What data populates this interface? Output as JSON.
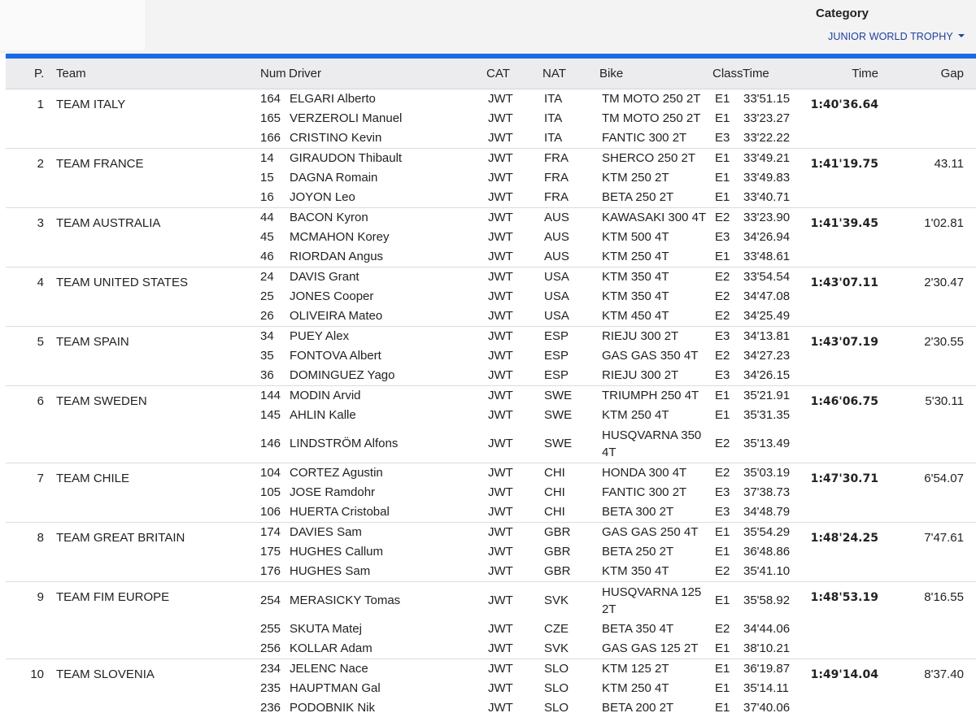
{
  "category": {
    "title": "Category",
    "selected": "JUNIOR WORLD TROPHY"
  },
  "columns": {
    "pos": "P.",
    "team": "Team",
    "num": "Num",
    "driver": "Driver",
    "cat": "CAT",
    "nat": "NAT",
    "bike": "Bike",
    "class": "Class",
    "class_time": "Time",
    "time": "Time",
    "gap": "Gap"
  },
  "teams": [
    {
      "pos": "1",
      "team": "TEAM ITALY",
      "time": "1:40'36.64",
      "gap": "",
      "riders": [
        {
          "num": "164",
          "driver": "ELGARI Alberto",
          "cat": "JWT",
          "nat": "ITA",
          "bike": "TM MOTO 250 2T",
          "class": "E1",
          "time": "33'51.15"
        },
        {
          "num": "165",
          "driver": "VERZEROLI Manuel",
          "cat": "JWT",
          "nat": "ITA",
          "bike": "TM MOTO 250 2T",
          "class": "E1",
          "time": "33'23.27"
        },
        {
          "num": "166",
          "driver": "CRISTINO Kevin",
          "cat": "JWT",
          "nat": "ITA",
          "bike": "FANTIC 300 2T",
          "class": "E3",
          "time": "33'22.22"
        }
      ]
    },
    {
      "pos": "2",
      "team": "TEAM FRANCE",
      "time": "1:41'19.75",
      "gap": "43.11",
      "riders": [
        {
          "num": "14",
          "driver": "GIRAUDON Thibault",
          "cat": "JWT",
          "nat": "FRA",
          "bike": "SHERCO 250 2T",
          "class": "E1",
          "time": "33'49.21"
        },
        {
          "num": "15",
          "driver": "DAGNA Romain",
          "cat": "JWT",
          "nat": "FRA",
          "bike": "KTM 250 2T",
          "class": "E1",
          "time": "33'49.83"
        },
        {
          "num": "16",
          "driver": "JOYON Leo",
          "cat": "JWT",
          "nat": "FRA",
          "bike": "BETA 250 2T",
          "class": "E1",
          "time": "33'40.71"
        }
      ]
    },
    {
      "pos": "3",
      "team": "TEAM AUSTRALIA",
      "time": "1:41'39.45",
      "gap": "1'02.81",
      "riders": [
        {
          "num": "44",
          "driver": "BACON Kyron",
          "cat": "JWT",
          "nat": "AUS",
          "bike": "KAWASAKI 300 4T",
          "class": "E2",
          "time": "33'23.90"
        },
        {
          "num": "45",
          "driver": "MCMAHON Korey",
          "cat": "JWT",
          "nat": "AUS",
          "bike": "KTM 500 4T",
          "class": "E3",
          "time": "34'26.94"
        },
        {
          "num": "46",
          "driver": "RIORDAN Angus",
          "cat": "JWT",
          "nat": "AUS",
          "bike": "KTM 250 4T",
          "class": "E1",
          "time": "33'48.61"
        }
      ]
    },
    {
      "pos": "4",
      "team": "TEAM UNITED STATES",
      "time": "1:43'07.11",
      "gap": "2'30.47",
      "riders": [
        {
          "num": "24",
          "driver": "DAVIS Grant",
          "cat": "JWT",
          "nat": "USA",
          "bike": "KTM 350 4T",
          "class": "E2",
          "time": "33'54.54"
        },
        {
          "num": "25",
          "driver": "JONES Cooper",
          "cat": "JWT",
          "nat": "USA",
          "bike": "KTM 350 4T",
          "class": "E2",
          "time": "34'47.08"
        },
        {
          "num": "26",
          "driver": "OLIVEIRA Mateo",
          "cat": "JWT",
          "nat": "USA",
          "bike": "KTM 450 4T",
          "class": "E2",
          "time": "34'25.49"
        }
      ]
    },
    {
      "pos": "5",
      "team": "TEAM SPAIN",
      "time": "1:43'07.19",
      "gap": "2'30.55",
      "riders": [
        {
          "num": "34",
          "driver": "PUEY Alex",
          "cat": "JWT",
          "nat": "ESP",
          "bike": "RIEJU 300 2T",
          "class": "E3",
          "time": "34'13.81"
        },
        {
          "num": "35",
          "driver": "FONTOVA Albert",
          "cat": "JWT",
          "nat": "ESP",
          "bike": "GAS GAS 350 4T",
          "class": "E2",
          "time": "34'27.23"
        },
        {
          "num": "36",
          "driver": "DOMINGUEZ Yago",
          "cat": "JWT",
          "nat": "ESP",
          "bike": "RIEJU 300 2T",
          "class": "E3",
          "time": "34'26.15"
        }
      ]
    },
    {
      "pos": "6",
      "team": "TEAM SWEDEN",
      "time": "1:46'06.75",
      "gap": "5'30.11",
      "riders": [
        {
          "num": "144",
          "driver": "MODIN Arvid",
          "cat": "JWT",
          "nat": "SWE",
          "bike": "TRIUMPH 250 4T",
          "class": "E1",
          "time": "35'21.91"
        },
        {
          "num": "145",
          "driver": "AHLIN Kalle",
          "cat": "JWT",
          "nat": "SWE",
          "bike": "KTM 250 4T",
          "class": "E1",
          "time": "35'31.35"
        },
        {
          "num": "146",
          "driver": "LINDSTRÖM Alfons",
          "cat": "JWT",
          "nat": "SWE",
          "bike": "HUSQVARNA 350 4T",
          "class": "E2",
          "time": "35'13.49",
          "tall": true
        }
      ]
    },
    {
      "pos": "7",
      "team": "TEAM CHILE",
      "time": "1:47'30.71",
      "gap": "6'54.07",
      "riders": [
        {
          "num": "104",
          "driver": "CORTEZ Agustin",
          "cat": "JWT",
          "nat": "CHI",
          "bike": "HONDA 300 4T",
          "class": "E2",
          "time": "35'03.19"
        },
        {
          "num": "105",
          "driver": "JOSE Ramdohr",
          "cat": "JWT",
          "nat": "CHI",
          "bike": "FANTIC 300 2T",
          "class": "E3",
          "time": "37'38.73"
        },
        {
          "num": "106",
          "driver": "HUERTA Cristobal",
          "cat": "JWT",
          "nat": "CHI",
          "bike": "BETA 300 2T",
          "class": "E3",
          "time": "34'48.79"
        }
      ]
    },
    {
      "pos": "8",
      "team": "TEAM GREAT BRITAIN",
      "time": "1:48'24.25",
      "gap": "7'47.61",
      "riders": [
        {
          "num": "174",
          "driver": "DAVIES Sam",
          "cat": "JWT",
          "nat": "GBR",
          "bike": "GAS GAS 250 4T",
          "class": "E1",
          "time": "35'54.29"
        },
        {
          "num": "175",
          "driver": "HUGHES Callum",
          "cat": "JWT",
          "nat": "GBR",
          "bike": "BETA 250 2T",
          "class": "E1",
          "time": "36'48.86"
        },
        {
          "num": "176",
          "driver": "HUGHES Sam",
          "cat": "JWT",
          "nat": "GBR",
          "bike": "KTM 350 4T",
          "class": "E2",
          "time": "35'41.10"
        }
      ]
    },
    {
      "pos": "9",
      "team": "TEAM FIM EUROPE",
      "time": "1:48'53.19",
      "gap": "8'16.55",
      "riders": [
        {
          "num": "254",
          "driver": "MERASICKY Tomas",
          "cat": "JWT",
          "nat": "SVK",
          "bike": "HUSQVARNA 125 2T",
          "class": "E1",
          "time": "35'58.92",
          "tall": true
        },
        {
          "num": "255",
          "driver": "SKUTA Matej",
          "cat": "JWT",
          "nat": "CZE",
          "bike": "BETA 350 4T",
          "class": "E2",
          "time": "34'44.06"
        },
        {
          "num": "256",
          "driver": "KOLLAR Adam",
          "cat": "JWT",
          "nat": "SVK",
          "bike": "GAS GAS 125 2T",
          "class": "E1",
          "time": "38'10.21"
        }
      ]
    },
    {
      "pos": "10",
      "team": "TEAM SLOVENIA",
      "time": "1:49'14.04",
      "gap": "8'37.40",
      "riders": [
        {
          "num": "234",
          "driver": "JELENC Nace",
          "cat": "JWT",
          "nat": "SLO",
          "bike": "KTM 125 2T",
          "class": "E1",
          "time": "36'19.87"
        },
        {
          "num": "235",
          "driver": "HAUPTMAN Gal",
          "cat": "JWT",
          "nat": "SLO",
          "bike": "KTM 250 4T",
          "class": "E1",
          "time": "35'14.11"
        },
        {
          "num": "236",
          "driver": "PODOBNIK Nik",
          "cat": "JWT",
          "nat": "SLO",
          "bike": "BETA 200 2T",
          "class": "E1",
          "time": "37'40.06"
        }
      ]
    }
  ]
}
